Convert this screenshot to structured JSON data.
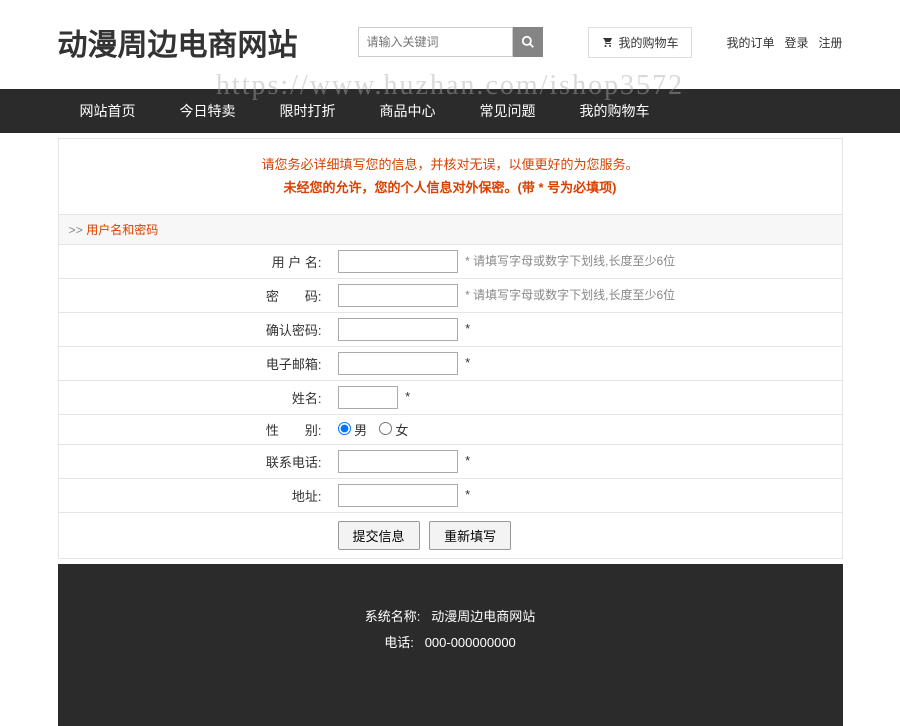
{
  "header": {
    "site_title": "动漫周边电商网站",
    "search_placeholder": "请输入关键词",
    "cart_label": "我的购物车",
    "top_links": {
      "orders": "我的订单",
      "login": "登录",
      "register": "注册"
    }
  },
  "watermark": "https://www.huzhan.com/ishop3572",
  "nav": {
    "home": "网站首页",
    "today": "今日特卖",
    "discount": "限时打折",
    "center": "商品中心",
    "faq": "常见问题",
    "cart": "我的购物车"
  },
  "notice": {
    "line1": "请您务必详细填写您的信息，并核对无误，以便更好的为您服务。",
    "line2": "未经您的允许，您的个人信息对外保密。(带 * 号为必填项)"
  },
  "section": {
    "arrows": ">>",
    "title": "用户名和密码"
  },
  "form": {
    "username": {
      "label": "用 户 名:",
      "hint": "* 请填写字母或数字下划线,长度至少6位"
    },
    "password": {
      "label": "密　　码:",
      "hint": "* 请填写字母或数字下划线,长度至少6位"
    },
    "confirm": {
      "label": "确认密码:",
      "star": "*"
    },
    "email": {
      "label": "电子邮箱:",
      "star": "*"
    },
    "realname": {
      "label": "姓名:",
      "star": "*"
    },
    "gender": {
      "label": "性　　别:",
      "male": "男",
      "female": "女"
    },
    "phone": {
      "label": "联系电话:",
      "star": "*"
    },
    "address": {
      "label": "地址:",
      "star": "*"
    },
    "buttons": {
      "submit": "提交信息",
      "reset": "重新填写"
    }
  },
  "footer": {
    "sysname_label": "系统名称:",
    "sysname_value": "动漫周边电商网站",
    "tel_label": "电话:",
    "tel_value": "000-000000000"
  }
}
